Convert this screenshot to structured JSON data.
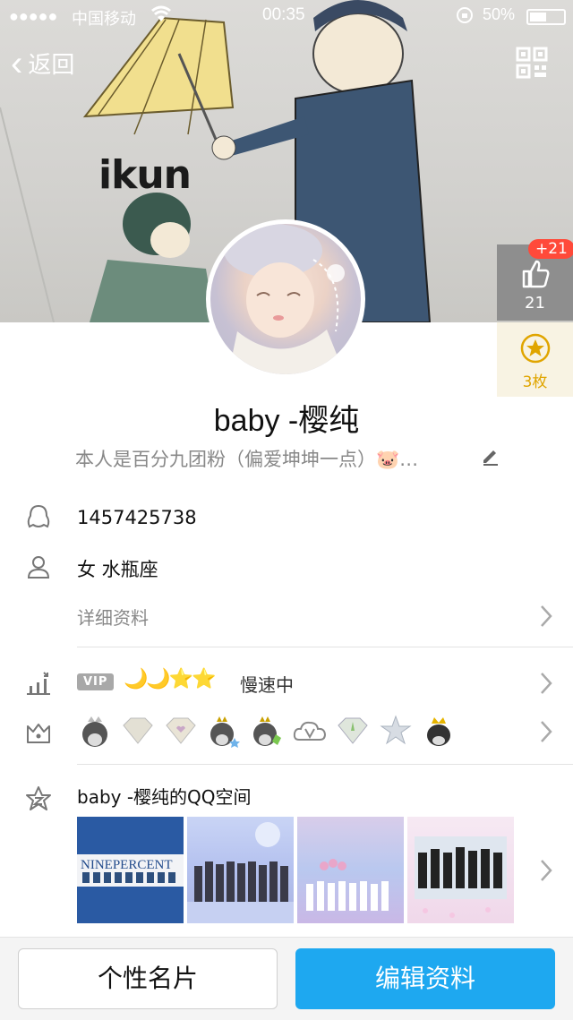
{
  "statusbar": {
    "signal": "●●●●●",
    "carrier": "中国移动",
    "wifi": "wifi-icon",
    "time": "00:35",
    "battery": "50%"
  },
  "nav": {
    "back_label": "返回"
  },
  "cover": {
    "text": "ikun"
  },
  "side": {
    "likes_badge": "+21",
    "likes": "21",
    "stars": "3枚"
  },
  "profile": {
    "name": "baby -樱纯",
    "signature": "本人是百分九团粉（偏爱坤坤一点）🐷…"
  },
  "info": {
    "qq": "1457425738",
    "gender_sign": "女 水瓶座",
    "details_label": "详细资料",
    "vip_tag": "VIP",
    "levels": "🌙🌙⭐⭐",
    "speed": "慢速中",
    "qzone_title": "baby -樱纯的QQ空间"
  },
  "photos": [
    {
      "label": "NINEPERCENT"
    }
  ],
  "buttons": {
    "card": "个性名片",
    "edit": "编辑资料"
  },
  "colors": {
    "accent": "#1ea8f0",
    "badge_red": "#ff4a3a",
    "star_gold": "#e0a500"
  }
}
